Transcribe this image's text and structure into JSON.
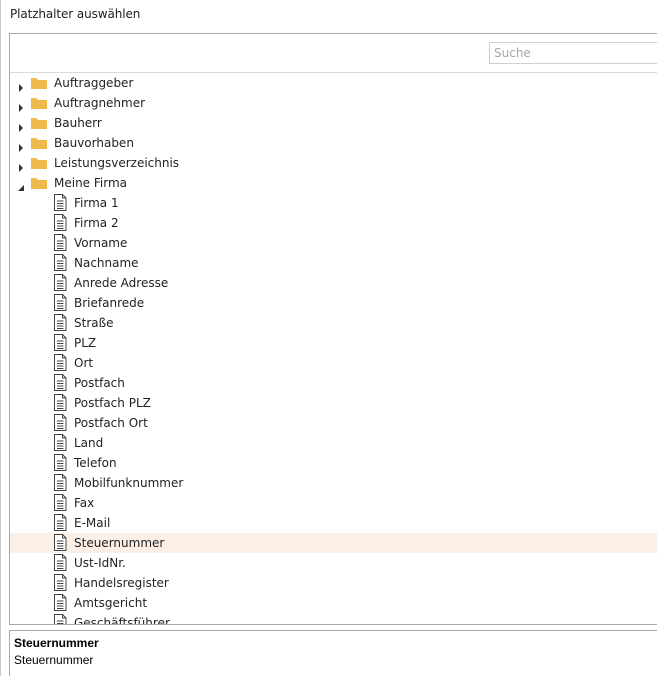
{
  "dialog": {
    "title": "Platzhalter auswählen"
  },
  "search": {
    "placeholder": "Suche",
    "value": ""
  },
  "tree": {
    "folders": [
      {
        "label": "Auftraggeber",
        "expanded": false
      },
      {
        "label": "Auftragnehmer",
        "expanded": false
      },
      {
        "label": "Bauherr",
        "expanded": false
      },
      {
        "label": "Bauvorhaben",
        "expanded": false
      },
      {
        "label": "Leistungsverzeichnis",
        "expanded": false
      },
      {
        "label": "Meine Firma",
        "expanded": true
      }
    ],
    "items": [
      {
        "label": "Firma 1"
      },
      {
        "label": "Firma 2"
      },
      {
        "label": "Vorname"
      },
      {
        "label": "Nachname"
      },
      {
        "label": "Anrede Adresse"
      },
      {
        "label": "Briefanrede"
      },
      {
        "label": "Straße"
      },
      {
        "label": "PLZ"
      },
      {
        "label": "Ort"
      },
      {
        "label": "Postfach"
      },
      {
        "label": "Postfach PLZ"
      },
      {
        "label": "Postfach Ort"
      },
      {
        "label": "Land"
      },
      {
        "label": "Telefon"
      },
      {
        "label": "Mobilfunknummer"
      },
      {
        "label": "Fax"
      },
      {
        "label": "E-Mail"
      },
      {
        "label": "Steuernummer",
        "selected": true
      },
      {
        "label": "Ust-IdNr."
      },
      {
        "label": "Handelsregister"
      },
      {
        "label": "Amtsgericht"
      },
      {
        "label": "Geschäftsführer"
      }
    ]
  },
  "description": {
    "title": "Steuernummer",
    "text": "Steuernummer"
  },
  "colors": {
    "folder": "#f0b94e",
    "selection": "#fcefe5",
    "border": "#a9a9a9"
  }
}
